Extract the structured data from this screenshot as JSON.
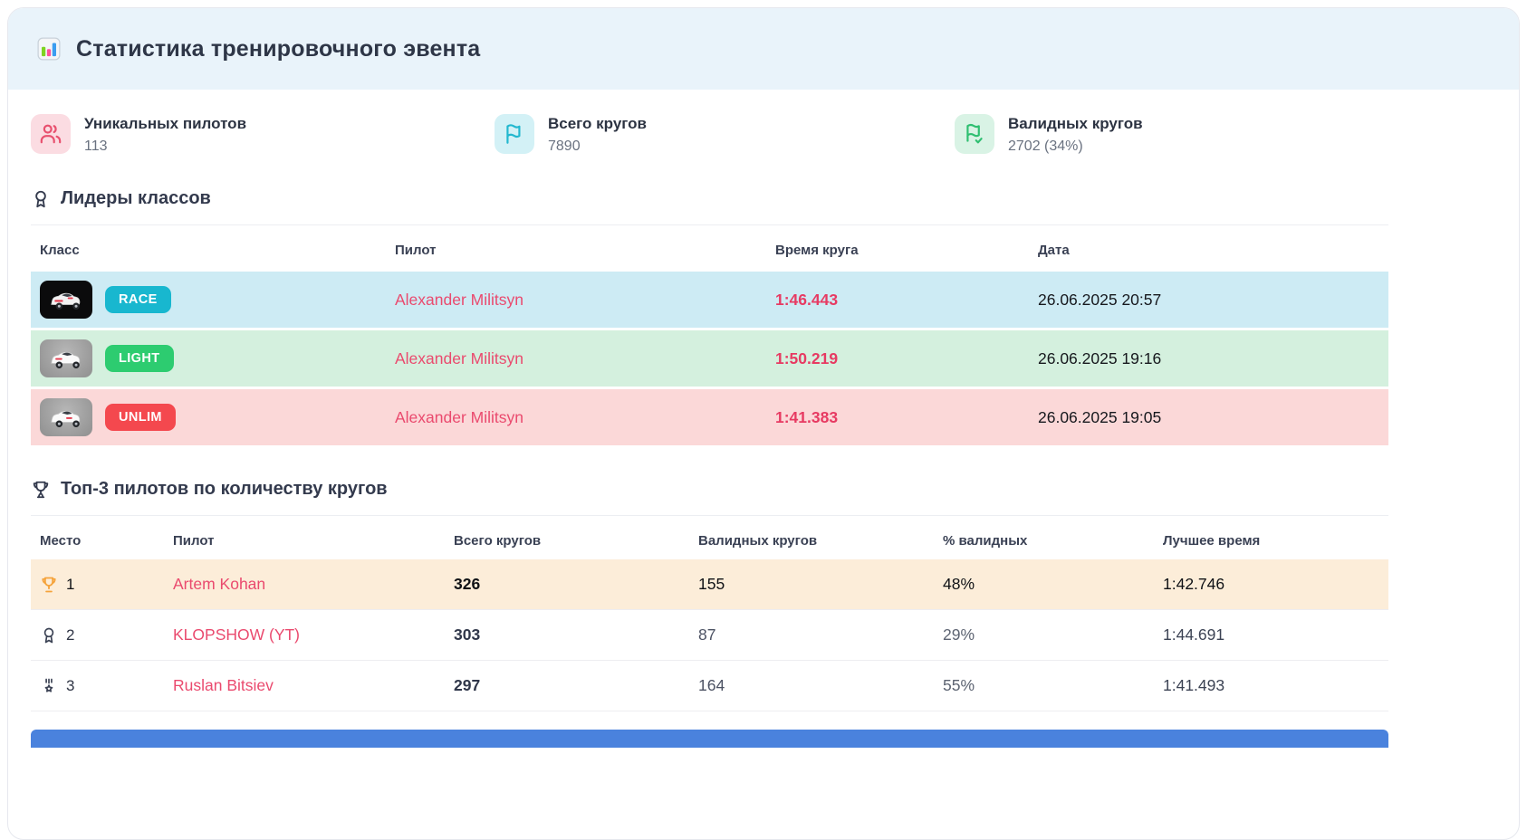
{
  "header": {
    "title": "Статистика тренировочного эвента"
  },
  "stats": [
    {
      "label": "Уникальных пилотов",
      "value": "113",
      "icon": "users-icon",
      "icon_color": "#e8506e",
      "icon_bg": "#fbdce2"
    },
    {
      "label": "Всего кругов",
      "value": "7890",
      "icon": "flag-icon",
      "icon_color": "#22b8cf",
      "icon_bg": "#d3f1f6"
    },
    {
      "label": "Валидных кругов",
      "value": "2702 (34%)",
      "icon": "flag-check-icon",
      "icon_color": "#2fbf71",
      "icon_bg": "#d9f3e5"
    }
  ],
  "class_leaders": {
    "title": "Лидеры классов",
    "section_icon": "award-icon",
    "columns": [
      "Класс",
      "Пилот",
      "Время круга",
      "Дата"
    ],
    "rows": [
      {
        "class_label": "RACE",
        "pilot": "Alexander Militsyn",
        "lap_time": "1:46.443",
        "date": "26.06.2025 20:57",
        "badge_color": "#18b7cf",
        "row_bg": "#cdebf4"
      },
      {
        "class_label": "LIGHT",
        "pilot": "Alexander Militsyn",
        "lap_time": "1:50.219",
        "date": "26.06.2025 19:16",
        "badge_color": "#2dcc70",
        "row_bg": "#d4f0de"
      },
      {
        "class_label": "UNLIM",
        "pilot": "Alexander Militsyn",
        "lap_time": "1:41.383",
        "date": "26.06.2025 19:05",
        "badge_color": "#f4484e",
        "row_bg": "#fbd8d8"
      }
    ]
  },
  "top_pilots": {
    "title": "Топ-3 пилотов по количеству кругов",
    "section_icon": "trophy-icon",
    "columns": [
      "Место",
      "Пилот",
      "Всего кругов",
      "Валидных кругов",
      "% валидных",
      "Лучшее время"
    ],
    "rows": [
      {
        "place": "1",
        "place_icon": "trophy-icon",
        "pilot": "Artem Kohan",
        "total_laps": "326",
        "valid_laps": "155",
        "valid_pct": "48%",
        "best_time": "1:42.746",
        "highlight": true
      },
      {
        "place": "2",
        "place_icon": "award-icon",
        "pilot": "KLOPSHOW (YT)",
        "total_laps": "303",
        "valid_laps": "87",
        "valid_pct": "29%",
        "best_time": "1:44.691",
        "highlight": false
      },
      {
        "place": "3",
        "place_icon": "medal-icon",
        "pilot": "Ruslan Bitsiev",
        "total_laps": "297",
        "valid_laps": "164",
        "valid_pct": "55%",
        "best_time": "1:41.493",
        "highlight": false
      }
    ]
  },
  "colors": {
    "header_bg": "#e9f3fa",
    "accent_pink": "#ea4a6e",
    "lap_time_red": "#e73a62",
    "trophy_orange": "#f5a33b",
    "top_row_highlight_bg": "#fcedd9",
    "bottom_bar_blue": "#4a82dd"
  }
}
